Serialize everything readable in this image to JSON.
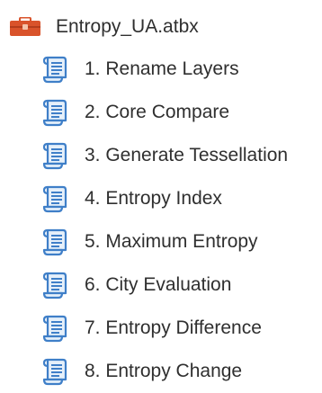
{
  "toolbox": {
    "name": "Entropy_UA.atbx",
    "icon": "toolbox-icon",
    "icon_color": "#d9532b"
  },
  "tools": [
    {
      "label": "1. Rename Layers",
      "icon": "script-tool-icon"
    },
    {
      "label": "2. Core Compare",
      "icon": "script-tool-icon"
    },
    {
      "label": "3. Generate Tessellation",
      "icon": "script-tool-icon"
    },
    {
      "label": "4. Entropy Index",
      "icon": "script-tool-icon"
    },
    {
      "label": "5. Maximum Entropy",
      "icon": "script-tool-icon"
    },
    {
      "label": "6. City Evaluation",
      "icon": "script-tool-icon"
    },
    {
      "label": "7. Entropy Difference",
      "icon": "script-tool-icon"
    },
    {
      "label": "8. Entropy Change",
      "icon": "script-tool-icon"
    }
  ],
  "colors": {
    "script_icon_stroke": "#3f7fc8",
    "script_icon_fill": "#e6f0fa"
  }
}
